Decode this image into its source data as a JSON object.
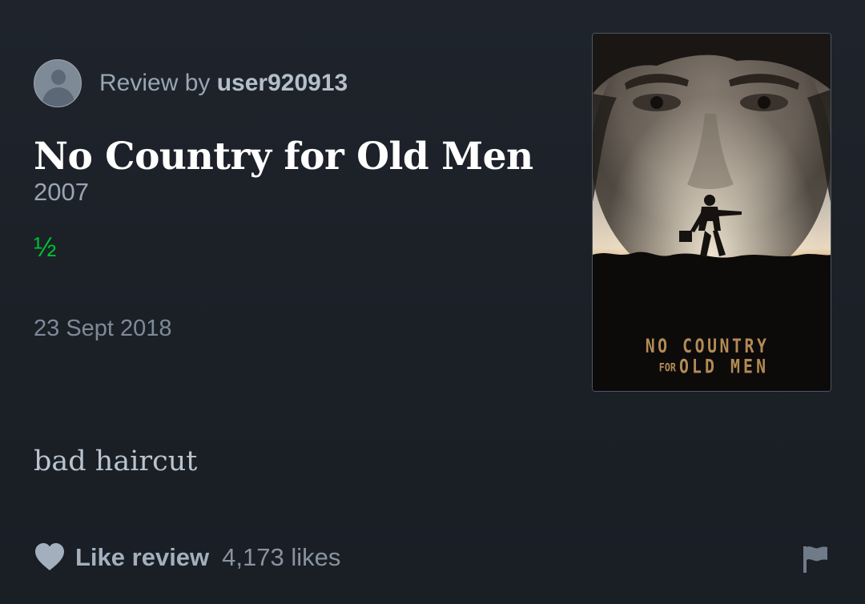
{
  "review": {
    "prefix": "Review by",
    "username": "user920913"
  },
  "film": {
    "title": "No Country for Old Men",
    "year": "2007",
    "rating": "½",
    "watched_date": "23 Sept 2018"
  },
  "body": {
    "text": "bad haircut"
  },
  "actions": {
    "like_label": "Like review",
    "like_count": "4,173 likes"
  },
  "poster": {
    "title_line1": "NO COUNTRY",
    "title_line2a": "FOR",
    "title_line2b": "OLD MEN"
  },
  "colors": {
    "background": "#1c2128",
    "rating_green": "#00c030",
    "title_white": "#ffffff",
    "muted_text": "#98a5b3"
  },
  "icons": {
    "avatar": "user-avatar-icon",
    "like": "heart-icon",
    "report": "flag-icon"
  }
}
